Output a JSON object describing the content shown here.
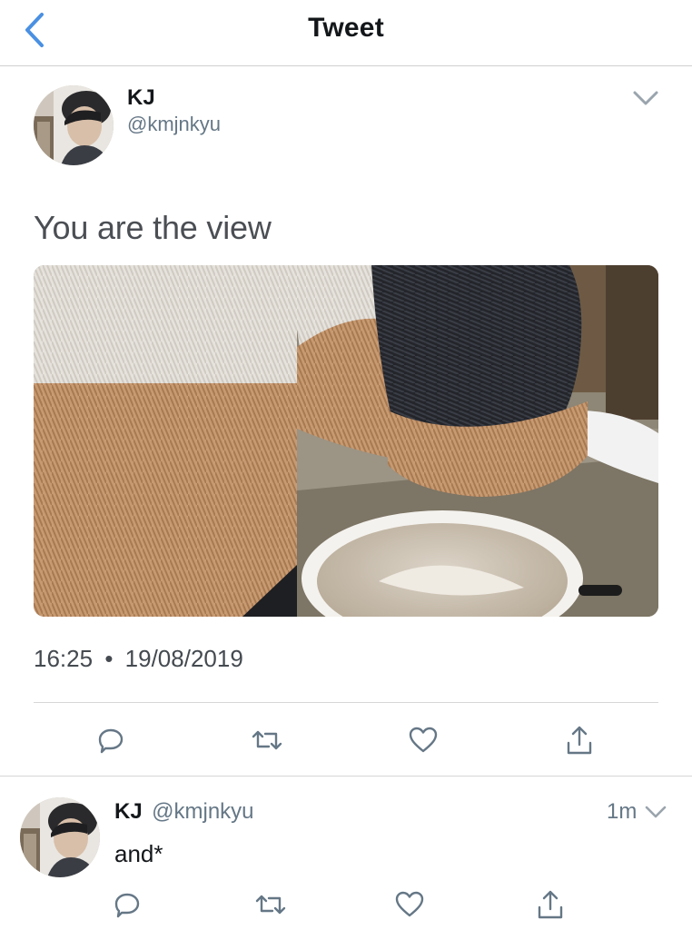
{
  "header": {
    "title": "Tweet",
    "back_icon": "chevron-left-icon"
  },
  "tweet": {
    "author_name": "KJ",
    "author_handle": "@kmjnkyu",
    "text": "You are the view",
    "time": "16:25",
    "separator": "•",
    "date": "19/08/2019",
    "actions": [
      "reply-icon",
      "retweet-icon",
      "like-icon",
      "share-icon"
    ]
  },
  "reply": {
    "author_name": "KJ",
    "author_handle": "@kmjnkyu",
    "time_ago": "1m",
    "text": "and*",
    "actions": [
      "reply-icon",
      "retweet-icon",
      "like-icon",
      "share-icon"
    ]
  },
  "colors": {
    "accent": "#4a90e2",
    "icon": "#657786",
    "divider": "#d6d6d6"
  }
}
